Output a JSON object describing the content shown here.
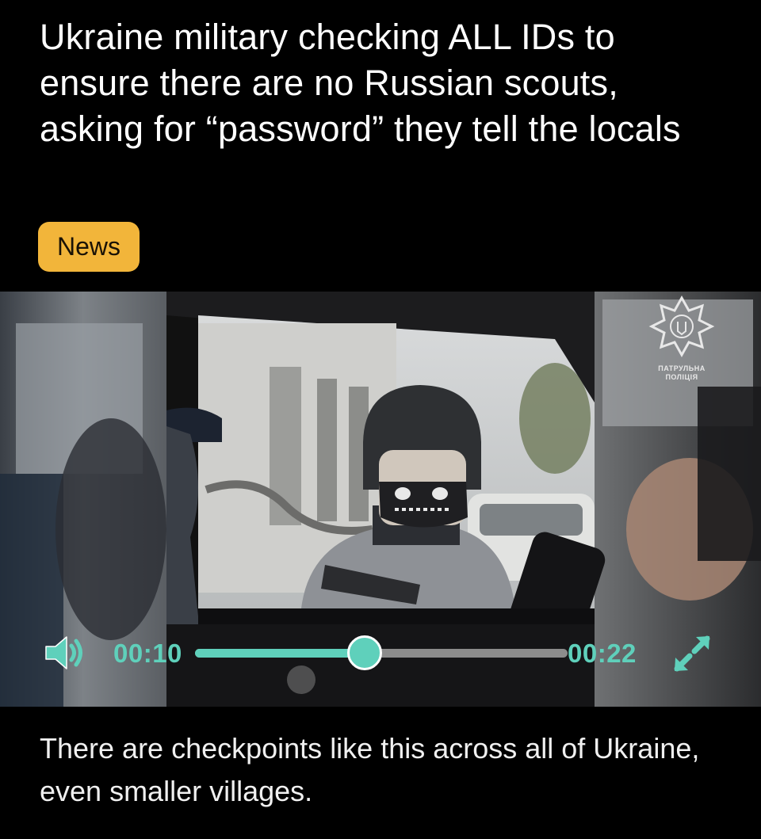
{
  "post": {
    "title": "Ukraine military checking ALL IDs to ensure there are no Russian scouts, asking for “password” they tell the locals",
    "tag": "News",
    "caption": "There are checkpoints like this across all of Ukraine, even smaller villages."
  },
  "video": {
    "current_time": "00:10",
    "duration": "00:22",
    "progress_fraction": 0.4545,
    "volume_icon": "speaker-volume-icon",
    "fullscreen_icon": "expand-arrows-icon",
    "watermark_text": "ПАТРУЛЬНА ПОЛІЦІЯ"
  },
  "colors": {
    "accent": "#5fd0bb",
    "tag_bg": "#f2b53a",
    "background": "#000000"
  }
}
